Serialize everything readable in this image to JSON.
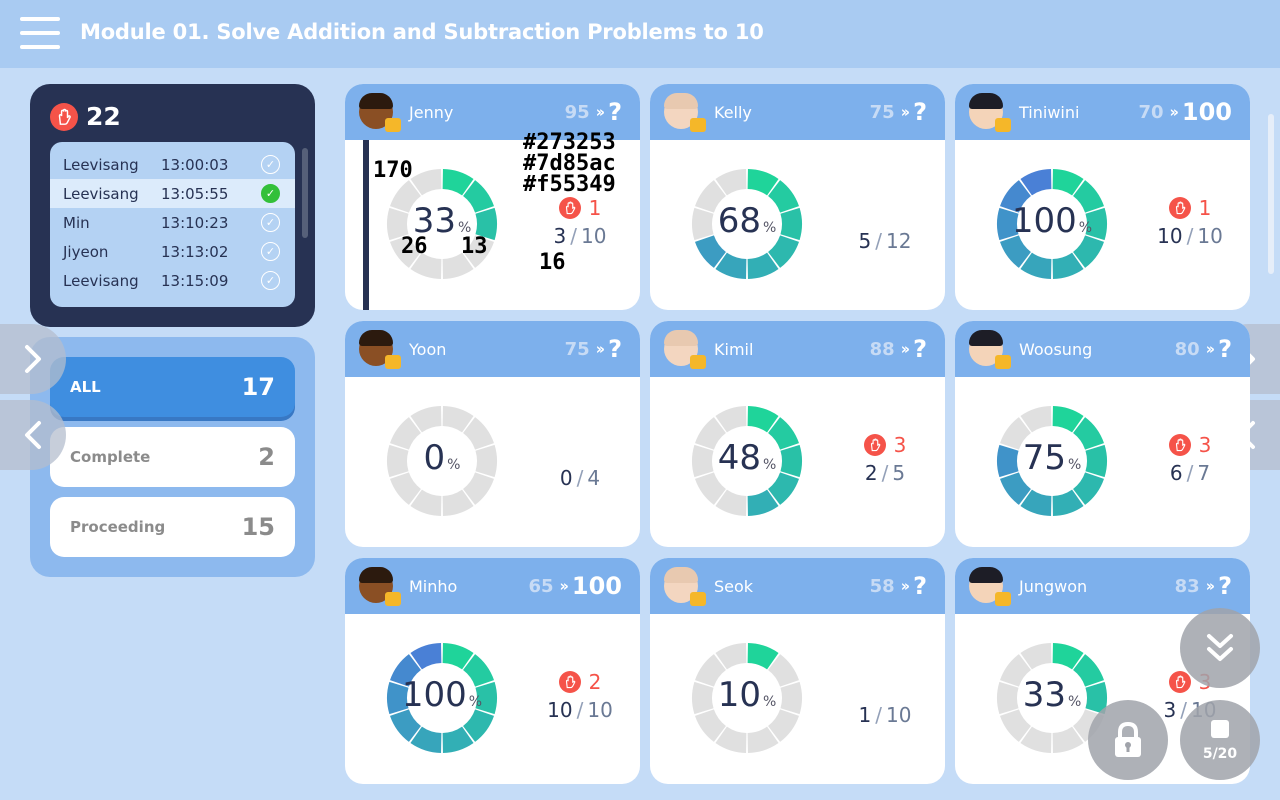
{
  "header": {
    "title": "Module 01. Solve Addition and Subtraction Problems to 10"
  },
  "hands": {
    "count": "22",
    "list": [
      {
        "name": "Leevisang",
        "time": "13:00:03",
        "done": false
      },
      {
        "name": "Leevisang",
        "time": "13:05:55",
        "done": true
      },
      {
        "name": "Min",
        "time": "13:10:23",
        "done": false
      },
      {
        "name": "Jiyeon",
        "time": "13:13:02",
        "done": false
      },
      {
        "name": "Leevisang",
        "time": "13:15:09",
        "done": false
      }
    ]
  },
  "filters": [
    {
      "label": "ALL",
      "count": "17",
      "active": true
    },
    {
      "label": "Complete",
      "count": "2",
      "active": false
    },
    {
      "label": "Proceeding",
      "count": "15",
      "active": false
    }
  ],
  "students": [
    {
      "name": "Jenny",
      "avatar": "dark",
      "prev": "95",
      "current": "?",
      "percent": "33",
      "hands": "1",
      "done": "3",
      "total": "10"
    },
    {
      "name": "Kelly",
      "avatar": "pale",
      "prev": "75",
      "current": "?",
      "percent": "68",
      "hands": "",
      "done": "5",
      "total": "12"
    },
    {
      "name": "Tiniwini",
      "avatar": "asian",
      "prev": "70",
      "current": "100",
      "percent": "100",
      "hands": "1",
      "done": "10",
      "total": "10"
    },
    {
      "name": "Yoon",
      "avatar": "dark",
      "prev": "75",
      "current": "?",
      "percent": "0",
      "hands": "",
      "done": "0",
      "total": "4"
    },
    {
      "name": "Kimil",
      "avatar": "pale",
      "prev": "88",
      "current": "?",
      "percent": "48",
      "hands": "3",
      "done": "2",
      "total": "5"
    },
    {
      "name": "Woosung",
      "avatar": "asian",
      "prev": "80",
      "current": "?",
      "percent": "75",
      "hands": "3",
      "done": "6",
      "total": "7"
    },
    {
      "name": "Minho",
      "avatar": "dark",
      "prev": "65",
      "current": "100",
      "percent": "100",
      "hands": "2",
      "done": "10",
      "total": "10"
    },
    {
      "name": "Seok",
      "avatar": "pale",
      "prev": "58",
      "current": "?",
      "percent": "10",
      "hands": "",
      "done": "1",
      "total": "10"
    },
    {
      "name": "Jungwon",
      "avatar": "asian",
      "prev": "83",
      "current": "?",
      "percent": "33",
      "hands": "3",
      "done": "3",
      "total": "10"
    }
  ],
  "jenny_annotations": {
    "colors": [
      "#273253",
      "#7d85ac",
      "#f55349"
    ],
    "bar_label": "170",
    "left_label": "26",
    "right_label": "13",
    "bottom_label": "16"
  },
  "pager": {
    "label": "5/20"
  },
  "colors": {
    "header": "#a9cbf2",
    "accent": "#3f8ee0",
    "ring_start": "#1fd49a",
    "ring_end": "#4a80d6",
    "ring_track": "#e0e0e0",
    "hand": "#f55349",
    "dark_panel": "#273253"
  }
}
